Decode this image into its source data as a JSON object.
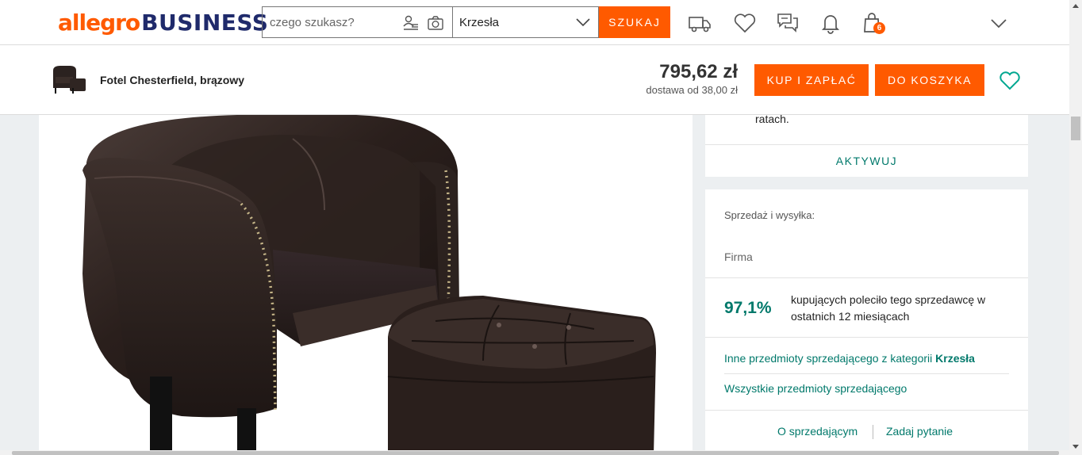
{
  "header": {
    "logo_part1": "allegro",
    "logo_part2": "BUSINESS",
    "search_placeholder": "czego szukasz?",
    "category": "Krzesła",
    "search_button": "SZUKAJ",
    "cart_count": "6",
    "icons": [
      "delivery-truck-icon",
      "heart-icon",
      "messages-icon",
      "bell-icon",
      "shopping-bag-icon",
      "chevron-down-icon"
    ]
  },
  "product_bar": {
    "title": "Fotel Chesterfield, brązowy",
    "price": "795,62 zł",
    "delivery": "dostawa od 38,00 zł",
    "buy_now": "KUP I ZAPŁAĆ",
    "add_to_cart": "DO KOSZYKA"
  },
  "promo_card": {
    "text_fragment": "ratach.",
    "activate": "AKTYWUJ"
  },
  "seller_card": {
    "label": "Sprzedaż i wysyłka:",
    "seller_type": "Firma",
    "recommend_percent": "97,1%",
    "recommend_text": "kupujących poleciło tego sprzedawcę w ostatnich 12 miesiącach",
    "other_items_prefix": "Inne przedmioty sprzedającego z kategorii",
    "other_items_category": "Krzesła",
    "all_items": "Wszystkie przedmioty sprzedającego",
    "about_seller": "O sprzedającym",
    "ask_question": "Zadaj pytanie"
  },
  "colors": {
    "brand_orange": "#ff5a00",
    "brand_navy": "#1f2a6b",
    "link_teal": "#00796b",
    "background": "#eceff1"
  }
}
